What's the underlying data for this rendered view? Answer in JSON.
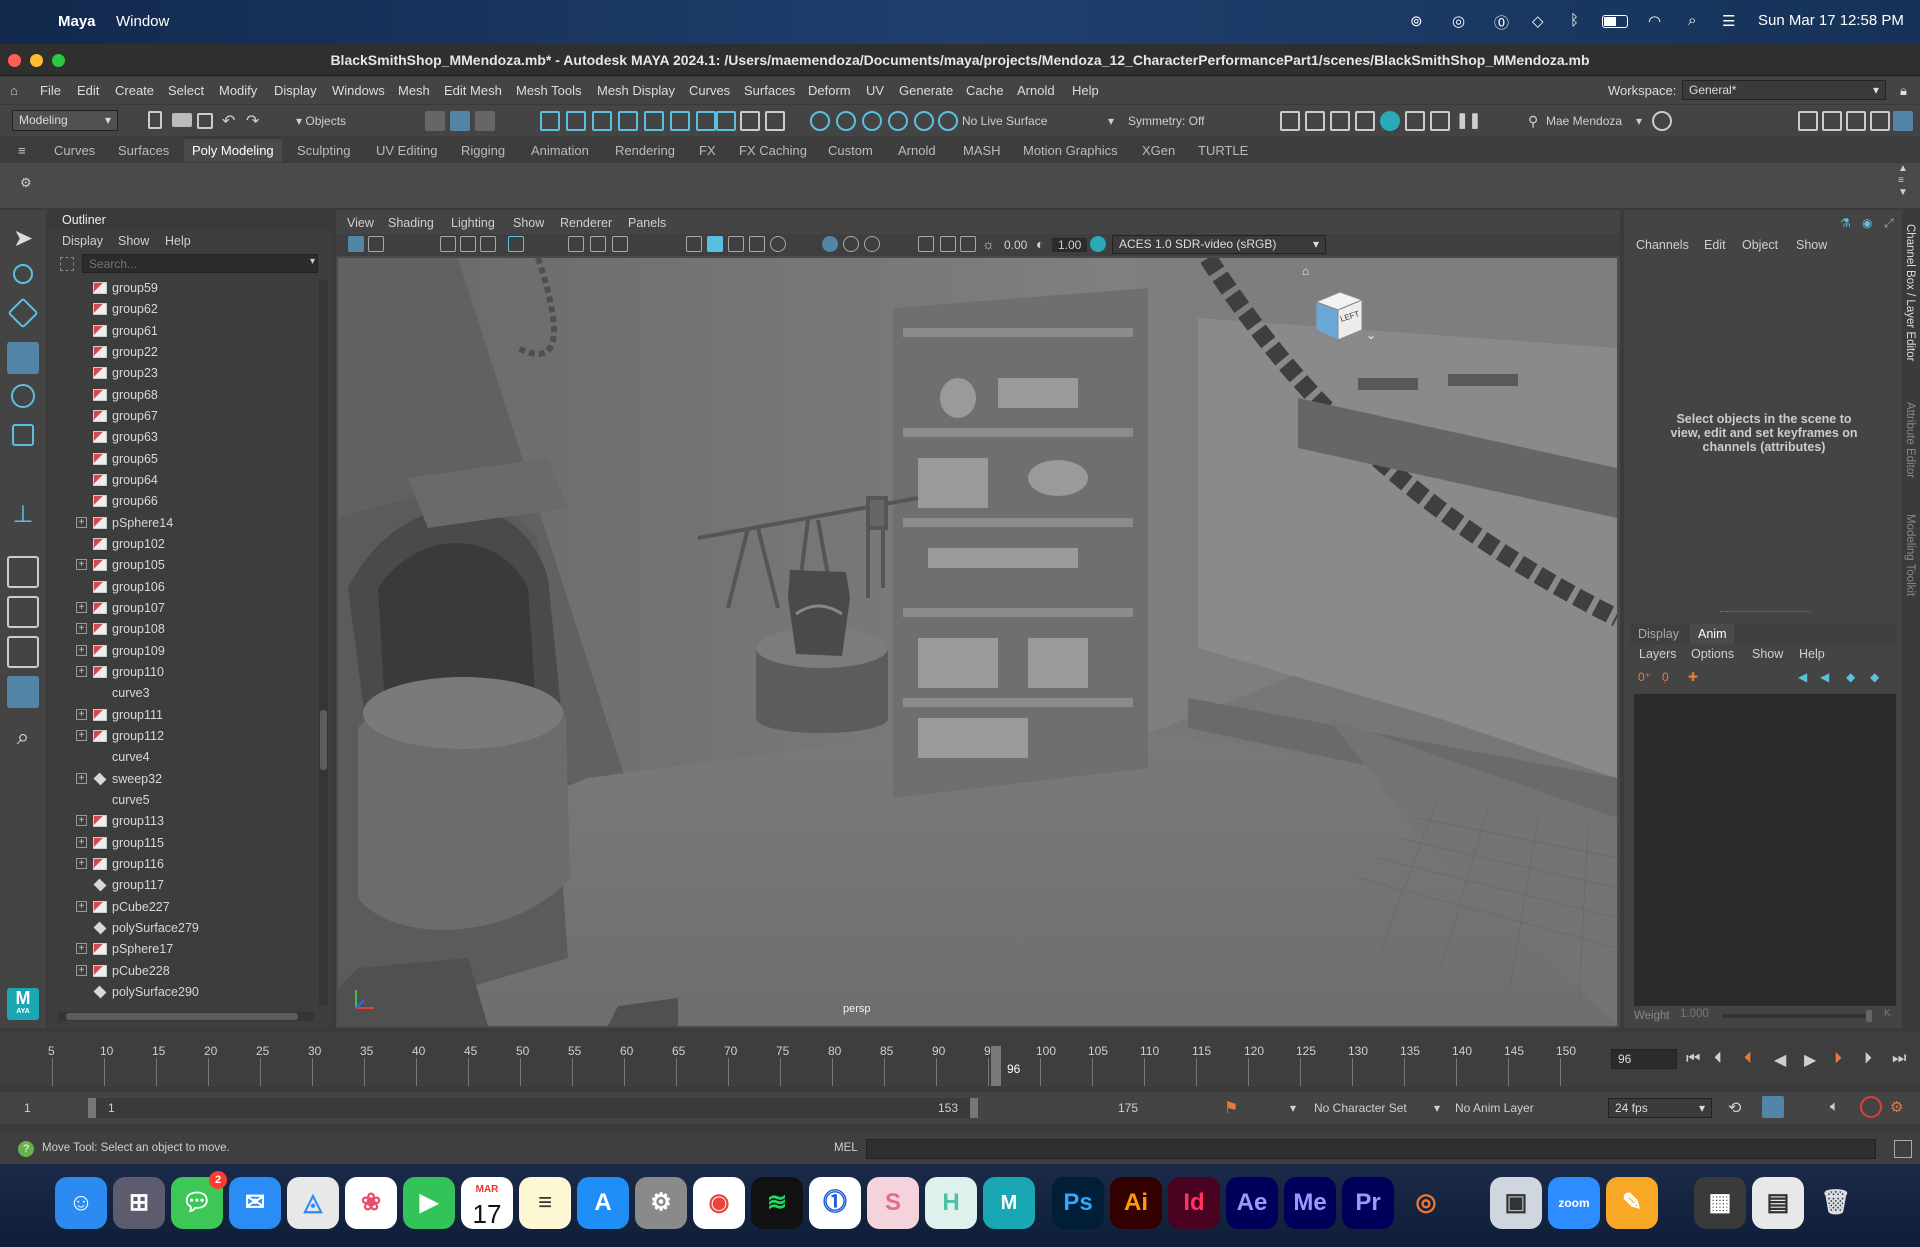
{
  "mac_menubar": {
    "app": "Maya",
    "items": [
      "Window"
    ],
    "clock": "Sun Mar 17  12:58 PM"
  },
  "window": {
    "title": "BlackSmithShop_MMendoza.mb* - Autodesk MAYA 2024.1: /Users/maemendoza/Documents/maya/projects/Mendoza_12_CharacterPerformancePart1/scenes/BlackSmithShop_MMendoza.mb"
  },
  "menu": {
    "items": [
      "File",
      "Edit",
      "Create",
      "Select",
      "Modify",
      "Display",
      "Windows",
      "Mesh",
      "Edit Mesh",
      "Mesh Tools",
      "Mesh Display",
      "Curves",
      "Surfaces",
      "Deform",
      "UV",
      "Generate",
      "Cache",
      "Arnold",
      "Help"
    ],
    "workspace_label": "Workspace:",
    "workspace_value": "General*"
  },
  "status": {
    "mode": "Modeling",
    "objects": "Objects",
    "live_surface": "No Live Surface",
    "symmetry": "Symmetry: Off",
    "user": "Mae Mendoza"
  },
  "shelf": {
    "tabs": [
      "Curves",
      "Surfaces",
      "Poly Modeling",
      "Sculpting",
      "UV Editing",
      "Rigging",
      "Animation",
      "Rendering",
      "FX",
      "FX Caching",
      "Custom",
      "Arnold",
      "MASH",
      "Motion Graphics",
      "XGen",
      "TURTLE"
    ],
    "active": "Poly Modeling"
  },
  "outliner": {
    "title": "Outliner",
    "menu": [
      "Display",
      "Show",
      "Help"
    ],
    "search_placeholder": "Search...",
    "rows": [
      {
        "name": "group59",
        "plus": false,
        "icon": "group"
      },
      {
        "name": "group62",
        "plus": false,
        "icon": "group"
      },
      {
        "name": "group61",
        "plus": false,
        "icon": "group"
      },
      {
        "name": "group22",
        "plus": false,
        "icon": "group"
      },
      {
        "name": "group23",
        "plus": false,
        "icon": "group"
      },
      {
        "name": "group68",
        "plus": false,
        "icon": "group"
      },
      {
        "name": "group67",
        "plus": false,
        "icon": "group"
      },
      {
        "name": "group63",
        "plus": false,
        "icon": "group"
      },
      {
        "name": "group65",
        "plus": false,
        "icon": "group"
      },
      {
        "name": "group64",
        "plus": false,
        "icon": "group"
      },
      {
        "name": "group66",
        "plus": false,
        "icon": "group"
      },
      {
        "name": "pSphere14",
        "plus": true,
        "icon": "group"
      },
      {
        "name": "group102",
        "plus": false,
        "icon": "group"
      },
      {
        "name": "group105",
        "plus": true,
        "icon": "group"
      },
      {
        "name": "group106",
        "plus": false,
        "icon": "group"
      },
      {
        "name": "group107",
        "plus": true,
        "icon": "group"
      },
      {
        "name": "group108",
        "plus": true,
        "icon": "group"
      },
      {
        "name": "group109",
        "plus": true,
        "icon": "group"
      },
      {
        "name": "group110",
        "plus": true,
        "icon": "group"
      },
      {
        "name": "curve3",
        "plus": false,
        "icon": "curve"
      },
      {
        "name": "group111",
        "plus": true,
        "icon": "group"
      },
      {
        "name": "group112",
        "plus": true,
        "icon": "group"
      },
      {
        "name": "curve4",
        "plus": false,
        "icon": "curve"
      },
      {
        "name": "sweep32",
        "plus": true,
        "icon": "mesh"
      },
      {
        "name": "curve5",
        "plus": false,
        "icon": "curve"
      },
      {
        "name": "group113",
        "plus": true,
        "icon": "group"
      },
      {
        "name": "group115",
        "plus": true,
        "icon": "group"
      },
      {
        "name": "group116",
        "plus": true,
        "icon": "group"
      },
      {
        "name": "group117",
        "plus": false,
        "icon": "mesh"
      },
      {
        "name": "pCube227",
        "plus": true,
        "icon": "group"
      },
      {
        "name": "polySurface279",
        "plus": false,
        "icon": "mesh"
      },
      {
        "name": "pSphere17",
        "plus": true,
        "icon": "group"
      },
      {
        "name": "pCube228",
        "plus": true,
        "icon": "group"
      },
      {
        "name": "polySurface290",
        "plus": false,
        "icon": "mesh"
      }
    ]
  },
  "viewport": {
    "menu": [
      "View",
      "Shading",
      "Lighting",
      "Show",
      "Renderer",
      "Panels"
    ],
    "exposure": "0.00",
    "gamma": "1.00",
    "color_space": "ACES 1.0 SDR-video (sRGB)",
    "camera": "persp",
    "viewcube_label": "LEFT"
  },
  "channelbox": {
    "menu": [
      "Channels",
      "Edit",
      "Object",
      "Show"
    ],
    "hint": "Select objects in the scene to view, edit and set keyframes on channels (attributes)",
    "layer_tabs": [
      "Display",
      "Anim"
    ],
    "layer_menu": [
      "Layers",
      "Options",
      "Show",
      "Help"
    ],
    "weight_label": "Weight",
    "weight_value": "1.000",
    "k": "K"
  },
  "side_tabs": [
    "Channel Box / Layer Editor",
    "Attribute Editor",
    "Modeling Toolkit"
  ],
  "timeline": {
    "ticks": [
      "5",
      "10",
      "15",
      "20",
      "25",
      "30",
      "35",
      "40",
      "45",
      "50",
      "55",
      "60",
      "65",
      "70",
      "75",
      "80",
      "85",
      "90",
      "95",
      "100",
      "105",
      "110",
      "115",
      "120",
      "125",
      "130",
      "135",
      "140",
      "145",
      "150"
    ],
    "current": "96",
    "current_field": "96"
  },
  "range": {
    "start": "1",
    "inner_start": "1",
    "inner_end": "153",
    "end": "175",
    "character_set": "No Character Set",
    "anim_layer": "No Anim Layer",
    "fps": "24 fps"
  },
  "helpline": {
    "text": "Move Tool: Select an object to move.",
    "mel": "MEL"
  },
  "dock": {
    "calendar_month": "MAR",
    "calendar_day": "17",
    "messages_badge": "2",
    "apps": [
      "Ps",
      "Ai",
      "Id",
      "Ae",
      "Me",
      "Pr",
      "zoom"
    ],
    "maya_letter": "M",
    "maya_sub": "AYA"
  },
  "colors": {
    "accent": "#5bc0de",
    "selected": "#5285a6"
  }
}
